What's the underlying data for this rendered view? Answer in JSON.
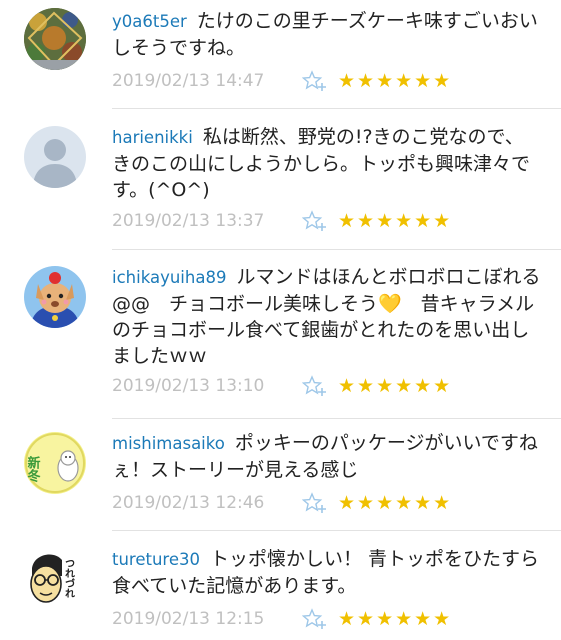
{
  "colors": {
    "username": "#1c7ab8",
    "timestamp": "#c0c0c0",
    "star": "#f0c000",
    "fav_icon": "#9ec7e8",
    "divider": "#e2e2e2"
  },
  "comments": [
    {
      "user": "y0a6t5er",
      "text": "たけのこの里チーズケーキ味すごいおいしそうですね。",
      "time": "2019/02/13 14:47",
      "stars": "★★★★★★",
      "rating": 6,
      "avatar_icon": "pattern-avatar"
    },
    {
      "user": "harienikki",
      "text": "私は断然、野党の!?きのこ党なので、きのこの山にしようかしら。トッポも興味津々です。(^O^)",
      "time": "2019/02/13 13:37",
      "stars": "★★★★★★",
      "rating": 6,
      "avatar_icon": "default-person-avatar"
    },
    {
      "user": "ichikayuiha89",
      "text": "ルマンドはほんとボロボロこぼれる@@　チョコボール美味しそう💛　昔キャラメルのチョコボール食べて銀歯がとれたのを思い出しましたｗｗ",
      "time": "2019/02/13 13:10",
      "stars": "★★★★★★",
      "rating": 6,
      "avatar_icon": "dog-character-avatar"
    },
    {
      "user": "mishimasaiko",
      "text": "ポッキーのパッケージがいいですねぇ！ストーリーが見える感じ",
      "time": "2019/02/13 12:46",
      "stars": "★★★★★★",
      "rating": 6,
      "avatar_icon": "new-winter-avatar",
      "avatar_text": "新冬"
    },
    {
      "user": "tureture30",
      "text": "トッポ懐かしい！ 青トッポをひたすら食べていた記憶があります。",
      "time": "2019/02/13 12:15",
      "stars": "★★★★★★",
      "rating": 6,
      "avatar_icon": "glasses-face-avatar",
      "avatar_text": "つれづれ"
    }
  ]
}
